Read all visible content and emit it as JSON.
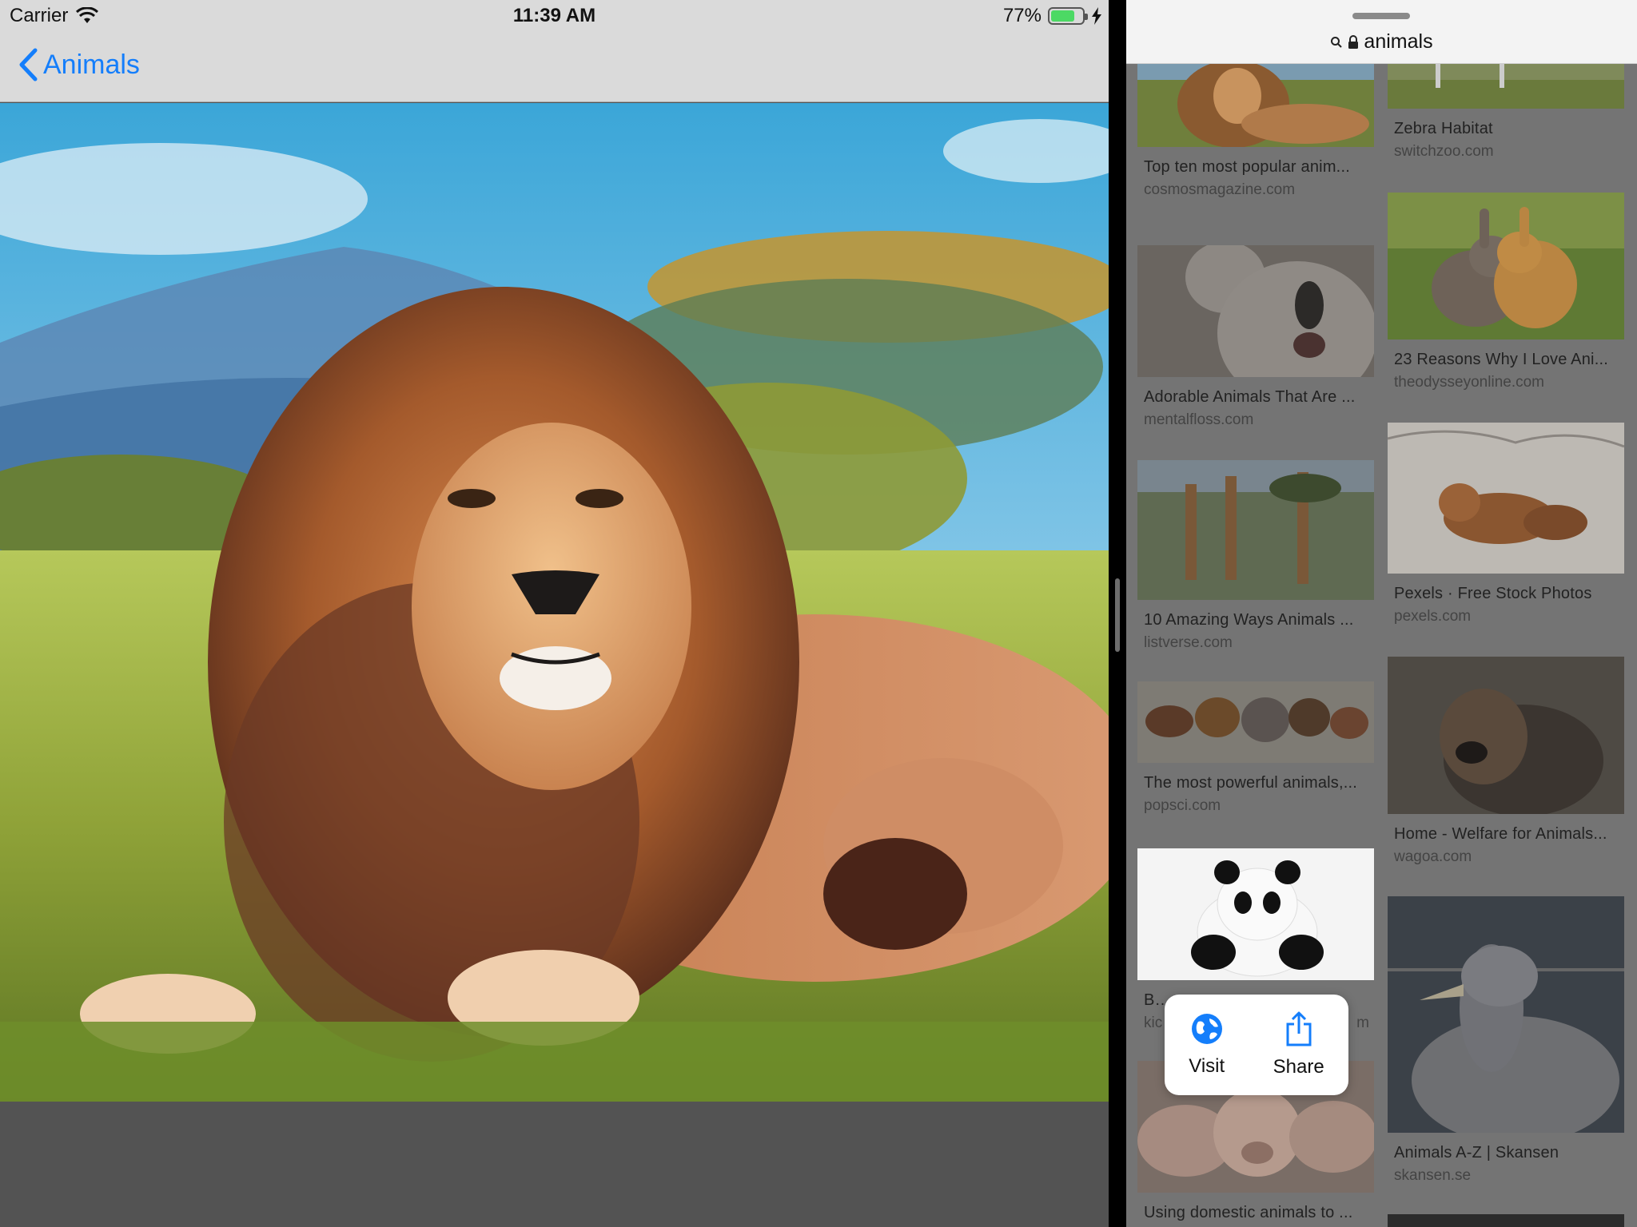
{
  "status_bar": {
    "carrier": "Carrier",
    "time": "11:39 AM",
    "battery": "77%",
    "battery_level": 0.77
  },
  "nav": {
    "back_label": "Animals"
  },
  "browser": {
    "url_text": "animals"
  },
  "results": [
    {
      "title": "Top ten most popular anim...",
      "source": "cosmosmagazine.com",
      "image": "lion"
    },
    {
      "title": "Zebra Habitat",
      "source": "switchzoo.com",
      "image": "zebra"
    },
    {
      "title": "Adorable Animals That Are ...",
      "source": "mentalfloss.com",
      "image": "koala"
    },
    {
      "title": "23 Reasons Why I Love Ani...",
      "source": "theodysseyonline.com",
      "image": "rabbits"
    },
    {
      "title": "10 Amazing Ways Animals ...",
      "source": "listverse.com",
      "image": "giraffes"
    },
    {
      "title": "Pexels · Free Stock Photos",
      "source": "pexels.com",
      "image": "tiger"
    },
    {
      "title": "The most powerful animals,...",
      "source": "popsci.com",
      "image": "animal-parade"
    },
    {
      "title": "Home - Welfare for Animals...",
      "source": "wagoa.com",
      "image": "dog"
    },
    {
      "title": "Bab",
      "source": "kic",
      "source_tail": "m",
      "image": "panda"
    },
    {
      "title": "Animals A-Z | Skansen",
      "source": "skansen.se",
      "image": "duck"
    },
    {
      "title": "Using domestic animals to ...",
      "source": "",
      "image": "pigs"
    }
  ],
  "popover": {
    "visit_label": "Visit",
    "share_label": "Share"
  },
  "colors": {
    "accent": "#147efb",
    "battery_green": "#4cd964"
  }
}
